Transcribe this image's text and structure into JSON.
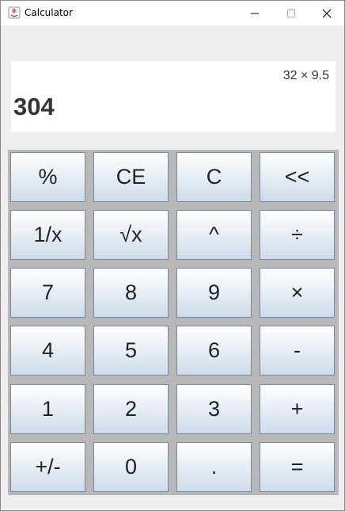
{
  "window": {
    "title": "Calculator"
  },
  "display": {
    "expression": "32 × 9.5",
    "result": "304"
  },
  "keys": [
    {
      "label": "%",
      "name": "percent-button"
    },
    {
      "label": "CE",
      "name": "clear-entry-button"
    },
    {
      "label": "C",
      "name": "clear-button"
    },
    {
      "label": "<<",
      "name": "backspace-button"
    },
    {
      "label": "1/x",
      "name": "reciprocal-button"
    },
    {
      "label": "√x",
      "name": "square-root-button"
    },
    {
      "label": "^",
      "name": "power-button"
    },
    {
      "label": "÷",
      "name": "divide-button"
    },
    {
      "label": "7",
      "name": "digit-7-button"
    },
    {
      "label": "8",
      "name": "digit-8-button"
    },
    {
      "label": "9",
      "name": "digit-9-button"
    },
    {
      "label": "×",
      "name": "multiply-button"
    },
    {
      "label": "4",
      "name": "digit-4-button"
    },
    {
      "label": "5",
      "name": "digit-5-button"
    },
    {
      "label": "6",
      "name": "digit-6-button"
    },
    {
      "label": "-",
      "name": "subtract-button"
    },
    {
      "label": "1",
      "name": "digit-1-button"
    },
    {
      "label": "2",
      "name": "digit-2-button"
    },
    {
      "label": "3",
      "name": "digit-3-button"
    },
    {
      "label": "+",
      "name": "add-button"
    },
    {
      "label": "+/-",
      "name": "negate-button"
    },
    {
      "label": "0",
      "name": "digit-0-button"
    },
    {
      "label": ".",
      "name": "decimal-point-button"
    },
    {
      "label": "=",
      "name": "equals-button"
    }
  ]
}
